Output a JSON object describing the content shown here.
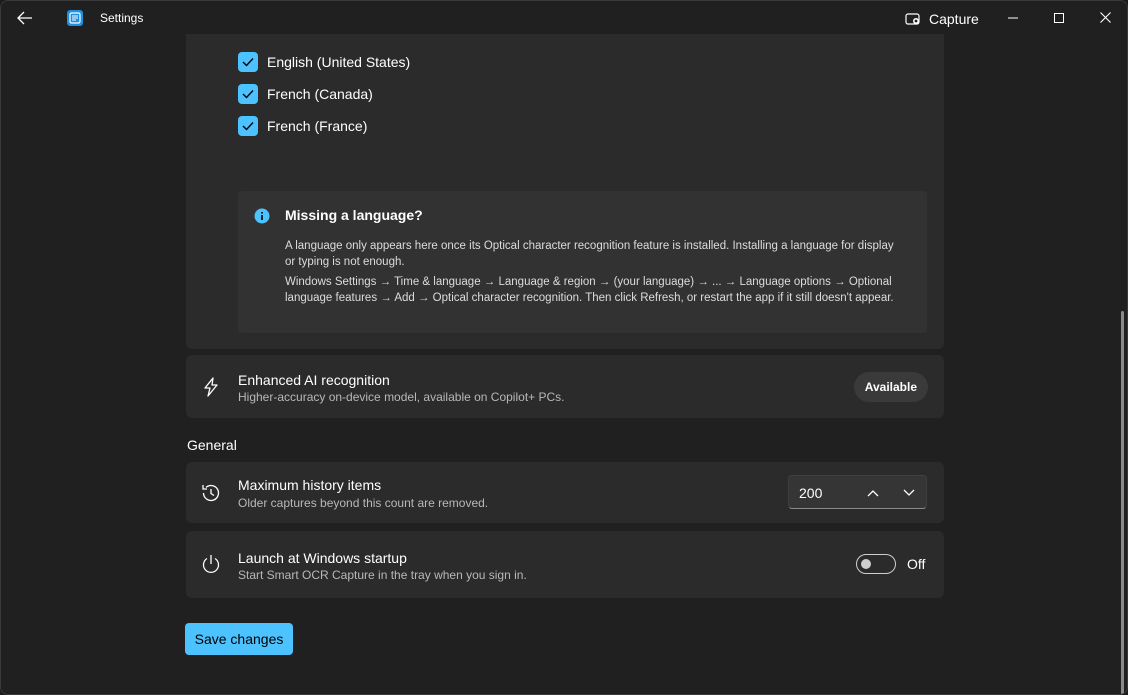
{
  "titlebar": {
    "title": "Settings",
    "capture_label": "Capture"
  },
  "languages": [
    {
      "label": "English (United States)",
      "checked": true
    },
    {
      "label": "French (Canada)",
      "checked": true
    },
    {
      "label": "French (France)",
      "checked": true
    }
  ],
  "info": {
    "title": "Missing a language?",
    "paragraph1": "A language only appears here once its Optical character recognition feature is installed. Installing a language for display or typing is not enough.",
    "paragraph2": "Windows Settings → Time & language → Language & region → (your language) → ... → Language options → Optional language features → Add → Optical character recognition. Then click Refresh, or restart the app if it still doesn't appear."
  },
  "ai": {
    "title": "Enhanced AI recognition",
    "subtitle": "Higher-accuracy on-device model, available on Copilot+ PCs.",
    "badge": "Available"
  },
  "general": {
    "section_label": "General",
    "history": {
      "title": "Maximum history items",
      "subtitle": "Older captures beyond this count are removed.",
      "value": "200"
    },
    "startup": {
      "title": "Launch at Windows startup",
      "subtitle": "Start Smart OCR Capture in the tray when you sign in.",
      "state": "Off"
    }
  },
  "save_label": "Save changes",
  "colors": {
    "accent": "#4cc2ff",
    "background": "#202020",
    "card": "#2b2b2b"
  }
}
